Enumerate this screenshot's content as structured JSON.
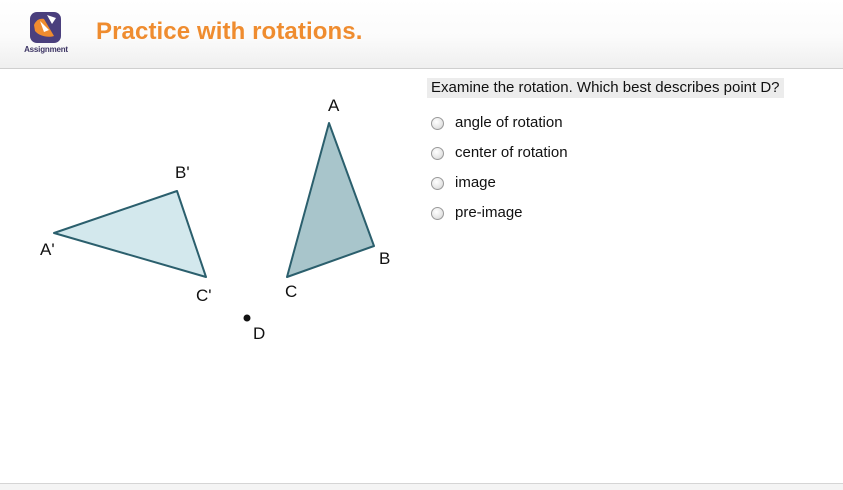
{
  "header": {
    "logo_text": "Assignment",
    "title": "Practice with rotations."
  },
  "diagram": {
    "labels": {
      "A": "A",
      "B": "B",
      "C": "C",
      "A_prime": "A'",
      "B_prime": "B'",
      "C_prime": "C'",
      "D": "D"
    },
    "colors": {
      "preimage_fill": "#a8c5cb",
      "image_fill": "#d3e8ed",
      "outline": "#2b5f6d"
    }
  },
  "question": {
    "text": "Examine the rotation. Which best describes point D?",
    "options": [
      {
        "label": "angle of rotation"
      },
      {
        "label": "center of rotation"
      },
      {
        "label": "image"
      },
      {
        "label": "pre-image"
      }
    ]
  }
}
